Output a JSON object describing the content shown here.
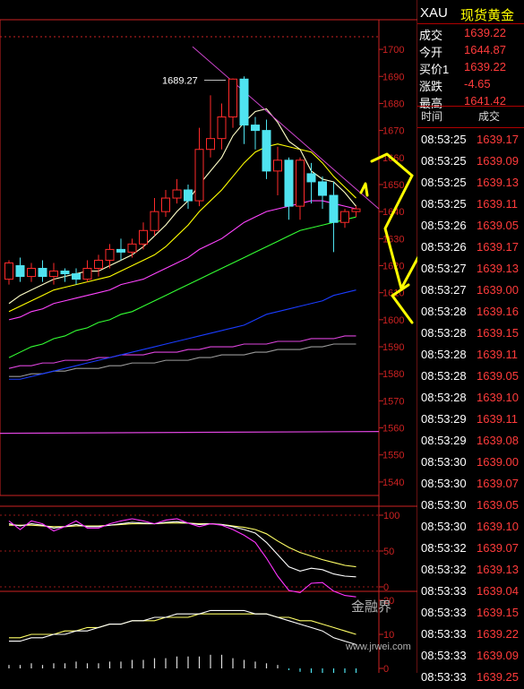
{
  "header": {
    "symbol": "XAU",
    "name": "现货黄金"
  },
  "quote": [
    {
      "label": "成交",
      "value": "1639.22"
    },
    {
      "label": "今开",
      "value": "1644.87"
    },
    {
      "label": "买价1",
      "value": "1639.22"
    },
    {
      "label": "涨跌",
      "value": "-4.65"
    },
    {
      "label": "最高",
      "value": "1641.42"
    }
  ],
  "ticks_header": {
    "time": "时间",
    "deal": "成交"
  },
  "ticks": [
    {
      "time": "08:53:25",
      "price": "1639.17"
    },
    {
      "time": "08:53:25",
      "price": "1639.09"
    },
    {
      "time": "08:53:25",
      "price": "1639.13"
    },
    {
      "time": "08:53:25",
      "price": "1639.11"
    },
    {
      "time": "08:53:26",
      "price": "1639.05"
    },
    {
      "time": "08:53:26",
      "price": "1639.17"
    },
    {
      "time": "08:53:27",
      "price": "1639.13"
    },
    {
      "time": "08:53:27",
      "price": "1639.00"
    },
    {
      "time": "08:53:28",
      "price": "1639.16"
    },
    {
      "time": "08:53:28",
      "price": "1639.15"
    },
    {
      "time": "08:53:28",
      "price": "1639.11"
    },
    {
      "time": "08:53:28",
      "price": "1639.05"
    },
    {
      "time": "08:53:28",
      "price": "1639.10"
    },
    {
      "time": "08:53:29",
      "price": "1639.11"
    },
    {
      "time": "08:53:29",
      "price": "1639.08"
    },
    {
      "time": "08:53:30",
      "price": "1639.00"
    },
    {
      "time": "08:53:30",
      "price": "1639.07"
    },
    {
      "time": "08:53:30",
      "price": "1639.05"
    },
    {
      "time": "08:53:30",
      "price": "1639.10"
    },
    {
      "time": "08:53:32",
      "price": "1639.07"
    },
    {
      "time": "08:53:32",
      "price": "1639.13"
    },
    {
      "time": "08:53:33",
      "price": "1639.04"
    },
    {
      "time": "08:53:33",
      "price": "1639.15"
    },
    {
      "time": "08:53:33",
      "price": "1639.22"
    },
    {
      "time": "08:53:33",
      "price": "1639.09"
    },
    {
      "time": "08:53:33",
      "price": "1639.25"
    }
  ],
  "watermark": {
    "brand": "金融界",
    "url": "www.jrwei.com"
  },
  "colors": {
    "up": "#ff2a2a",
    "down": "#4fe3f0",
    "axis": "#cc2222",
    "ma5": "#ffffc8",
    "ma10": "#ffff00",
    "ma20": "#ff44ff",
    "ma30": "#33ff33",
    "ma60": "#1a3cff",
    "ma120": "#dd44dd",
    "trend": "#cc44cc",
    "arrow": "#ffff00"
  },
  "chart_data": {
    "type": "candlestick",
    "y_ticks": [
      1540,
      1550,
      1560,
      1570,
      1580,
      1590,
      1600,
      1610,
      1620,
      1630,
      1640,
      1650,
      1660,
      1670,
      1680,
      1690,
      1700
    ],
    "ylim": [
      1535,
      1705
    ],
    "annotation": "1689.27",
    "candles": [
      [
        1615,
        1621,
        1613,
        1622
      ],
      [
        1620,
        1616,
        1614,
        1623
      ],
      [
        1616,
        1619,
        1614,
        1621
      ],
      [
        1619,
        1616,
        1614,
        1622
      ],
      [
        1616,
        1618,
        1613,
        1621
      ],
      [
        1618,
        1617,
        1614,
        1619
      ],
      [
        1617,
        1615,
        1613,
        1619
      ],
      [
        1615,
        1619,
        1614,
        1622
      ],
      [
        1619,
        1622,
        1616,
        1624
      ],
      [
        1622,
        1626,
        1619,
        1628
      ],
      [
        1626,
        1625,
        1622,
        1630
      ],
      [
        1625,
        1628,
        1623,
        1630
      ],
      [
        1628,
        1633,
        1626,
        1636
      ],
      [
        1633,
        1640,
        1631,
        1645
      ],
      [
        1640,
        1645,
        1638,
        1648
      ],
      [
        1645,
        1648,
        1643,
        1652
      ],
      [
        1648,
        1644,
        1641,
        1650
      ],
      [
        1644,
        1663,
        1642,
        1671
      ],
      [
        1663,
        1667,
        1660,
        1683
      ],
      [
        1667,
        1675,
        1663,
        1680
      ],
      [
        1675,
        1689,
        1671,
        1689.27
      ],
      [
        1689,
        1672,
        1665,
        1690
      ],
      [
        1672,
        1670,
        1663,
        1675
      ],
      [
        1670,
        1655,
        1652,
        1674
      ],
      [
        1655,
        1659,
        1646,
        1664
      ],
      [
        1659,
        1642,
        1637,
        1660
      ],
      [
        1642,
        1659,
        1637,
        1660
      ],
      [
        1654,
        1651,
        1643,
        1658
      ],
      [
        1651,
        1646,
        1641,
        1653
      ],
      [
        1646,
        1636,
        1625,
        1651
      ],
      [
        1636,
        1640,
        1634,
        1641
      ],
      [
        1640,
        1641,
        1638,
        1642
      ]
    ],
    "ma5": [
      1606,
      1609,
      1611,
      1613,
      1615,
      1616,
      1617,
      1618,
      1618,
      1620,
      1622,
      1624,
      1627,
      1631,
      1635,
      1640,
      1644,
      1650,
      1655,
      1660,
      1668,
      1673,
      1677,
      1678,
      1673,
      1666,
      1663,
      1655,
      1652,
      1651,
      1647,
      1642
    ],
    "ma10": [
      1603,
      1605,
      1607,
      1609,
      1611,
      1612,
      1613,
      1614,
      1615,
      1616,
      1618,
      1620,
      1622,
      1624,
      1627,
      1631,
      1635,
      1640,
      1644,
      1648,
      1653,
      1658,
      1662,
      1664,
      1665,
      1664,
      1663,
      1662,
      1658,
      1653,
      1649,
      1645
    ],
    "ma20": [
      1600,
      1601,
      1603,
      1604,
      1606,
      1607,
      1608,
      1609,
      1610,
      1611,
      1613,
      1614,
      1615,
      1617,
      1619,
      1621,
      1623,
      1626,
      1628,
      1630,
      1633,
      1636,
      1638,
      1640,
      1641,
      1642,
      1643,
      1644,
      1644,
      1643,
      1642,
      1641
    ],
    "ma30": [
      1586,
      1588,
      1590,
      1591,
      1593,
      1594,
      1596,
      1597,
      1599,
      1600,
      1602,
      1603,
      1605,
      1607,
      1609,
      1611,
      1613,
      1615,
      1617,
      1619,
      1621,
      1623,
      1625,
      1627,
      1629,
      1631,
      1633,
      1634,
      1635,
      1636,
      1637,
      1638
    ],
    "ma60": [
      1578,
      1578,
      1579,
      1580,
      1581,
      1582,
      1583,
      1584,
      1585,
      1586,
      1587,
      1588,
      1589,
      1590,
      1591,
      1592,
      1593,
      1594,
      1595,
      1596,
      1597,
      1598,
      1600,
      1602,
      1603,
      1604,
      1605,
      1606,
      1607,
      1609,
      1610,
      1611
    ],
    "ma120": [
      1582,
      1583,
      1583,
      1584,
      1584,
      1585,
      1585,
      1585,
      1586,
      1586,
      1587,
      1587,
      1587,
      1588,
      1588,
      1588,
      1589,
      1589,
      1590,
      1590,
      1590,
      1591,
      1591,
      1591,
      1592,
      1592,
      1592,
      1593,
      1593,
      1593,
      1594,
      1594
    ],
    "ma250": [
      1579,
      1579,
      1580,
      1580,
      1581,
      1581,
      1582,
      1582,
      1582,
      1583,
      1583,
      1584,
      1584,
      1584,
      1585,
      1585,
      1585,
      1586,
      1586,
      1587,
      1587,
      1587,
      1588,
      1588,
      1589,
      1589,
      1589,
      1590,
      1590,
      1591,
      1591,
      1591
    ],
    "level_line": 1558,
    "kdj": {
      "ylim": [
        0,
        100
      ],
      "y_ticks": [
        0,
        50,
        100
      ],
      "k": [
        88,
        85,
        88,
        86,
        82,
        84,
        87,
        84,
        84,
        86,
        88,
        90,
        89,
        88,
        90,
        91,
        89,
        87,
        88,
        87,
        84,
        80,
        75,
        62,
        45,
        28,
        22,
        26,
        24,
        18,
        15,
        14
      ],
      "d": [
        86,
        86,
        86,
        85,
        84,
        84,
        85,
        85,
        85,
        86,
        87,
        88,
        88,
        88,
        89,
        89,
        89,
        88,
        88,
        87,
        85,
        83,
        80,
        74,
        64,
        55,
        48,
        43,
        38,
        34,
        30,
        28
      ],
      "j": [
        92,
        80,
        92,
        88,
        78,
        84,
        92,
        82,
        82,
        88,
        92,
        95,
        92,
        88,
        93,
        95,
        89,
        84,
        88,
        86,
        80,
        72,
        62,
        40,
        15,
        -5,
        -8,
        5,
        6,
        -6,
        -12,
        -14
      ]
    },
    "lower": {
      "ylim": [
        0,
        20
      ],
      "y_ticks": [
        0,
        10,
        20
      ],
      "line_a": [
        8,
        8,
        9,
        9,
        10,
        10,
        11,
        11,
        12,
        13,
        13,
        14,
        14,
        15,
        15,
        16,
        16,
        16,
        17,
        17,
        17,
        17,
        16,
        16,
        15,
        14,
        13,
        12,
        11,
        9,
        8,
        7
      ],
      "line_b": [
        9,
        9,
        10,
        10,
        10,
        11,
        11,
        12,
        12,
        13,
        13,
        14,
        14,
        14,
        15,
        15,
        15,
        16,
        16,
        16,
        16,
        16,
        16,
        16,
        15,
        15,
        14,
        14,
        13,
        12,
        11,
        10
      ],
      "bars": [
        2,
        2,
        3,
        2,
        3,
        3,
        4,
        3,
        3,
        4,
        4,
        5,
        5,
        6,
        6,
        7,
        7,
        7,
        8,
        8,
        6,
        5,
        4,
        3,
        2,
        -1,
        -2,
        -3,
        -4,
        -5,
        -6,
        -8
      ]
    }
  }
}
